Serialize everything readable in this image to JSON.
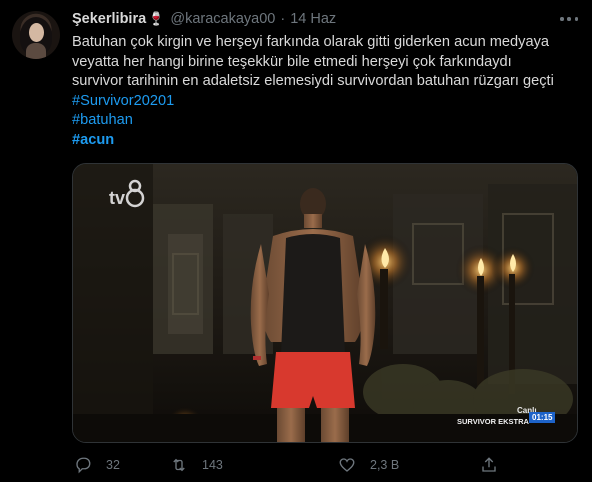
{
  "tweet": {
    "author_name": "Şekerlibira",
    "author_emoji": "🍷",
    "handle": "@karacakaya00",
    "separator": "·",
    "date": "14 Haz",
    "text_lines": [
      "Batuhan çok kirgin ve herşeyi farkında olarak gitti giderken acun medyaya",
      "veyatta her hangi birine teşekkür bile etmedi herşeyi  çok farkındaydı",
      "survivor  tarihinin en adaletsiz elemesiydi  survivordan batuhan rüzgarı geçti"
    ],
    "hashtags": [
      "#Survivor20201",
      "#batuhan",
      "#acun"
    ]
  },
  "media": {
    "channel_logo": "tv8",
    "overlay_live": "Canlı",
    "overlay_show": "SURVIVOR EKSTRA",
    "overlay_time": "01:15"
  },
  "actions": {
    "reply_count": "32",
    "retweet_count": "143",
    "like_count": "2,3 B",
    "share_label": ""
  },
  "icons": {
    "more": "more-horizontal-icon",
    "reply": "reply-icon",
    "retweet": "retweet-icon",
    "like": "heart-icon",
    "share": "share-icon"
  },
  "colors": {
    "background": "#000000",
    "text": "#d9d9d9",
    "muted": "#6e767d",
    "link": "#1d9bf0"
  }
}
